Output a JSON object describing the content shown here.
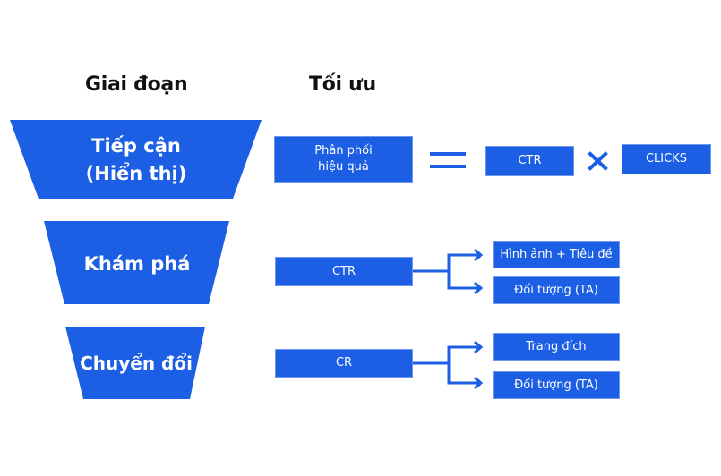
{
  "headers": {
    "stage": "Giai đoạn",
    "optimize": "Tối ưu"
  },
  "colors": {
    "primary": "#1c5fe5",
    "text": "#111111",
    "on_primary": "#ffffff"
  },
  "stages": [
    {
      "line1": "Tiếp cận",
      "line2": "(Hiển thị)"
    },
    {
      "line1": "Khám phá"
    },
    {
      "line1": "Chuyển đổi"
    }
  ],
  "row1": {
    "metric_line1": "Phân phối",
    "metric_line2": "hiệu quả",
    "operator_equals": "=",
    "factor1": "CTR",
    "operator_times": "×",
    "factor2": "CLICKS"
  },
  "row2": {
    "metric": "CTR",
    "branches": [
      "Hình ảnh + Tiêu đề",
      "Đối tượng (TA)"
    ]
  },
  "row3": {
    "metric": "CR",
    "branches": [
      "Trang đích",
      "Đối tượng (TA)"
    ]
  }
}
